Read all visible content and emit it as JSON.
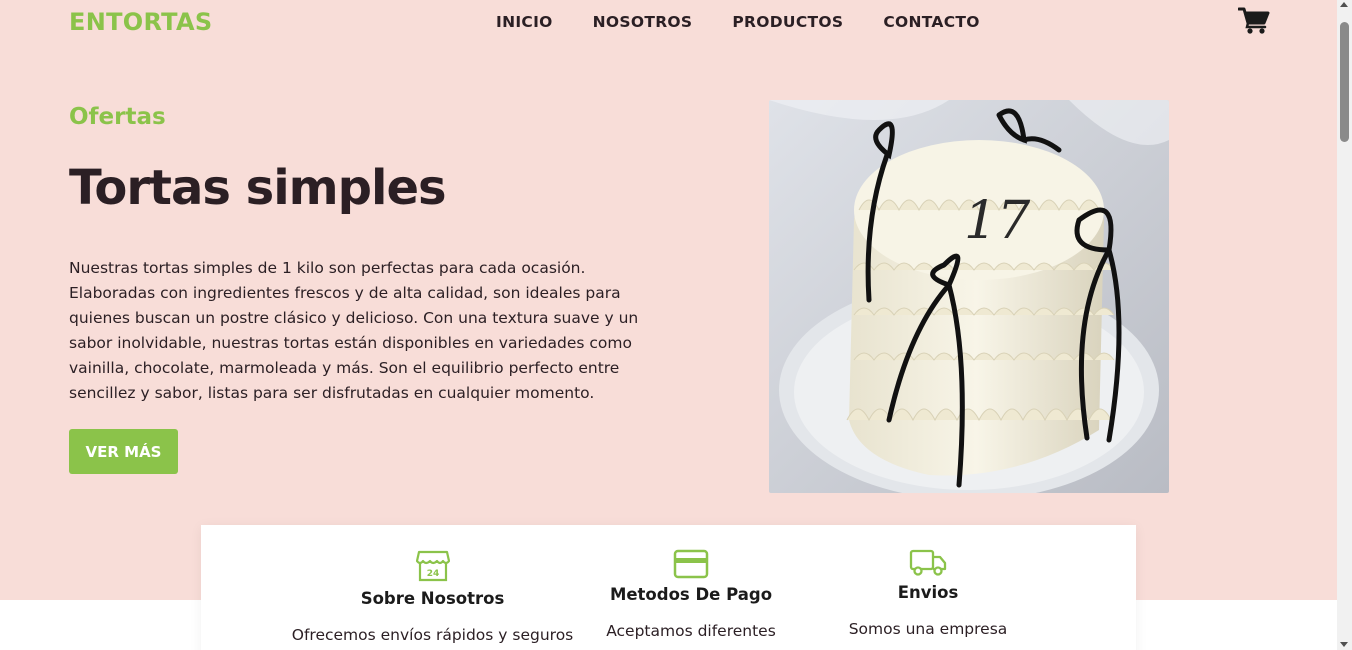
{
  "brand": {
    "name": "ENTORTAS",
    "accent": "#8bc34a",
    "hero_bg": "#f8ddd8"
  },
  "nav": {
    "items": [
      {
        "label": "INICIO"
      },
      {
        "label": "NOSOTROS"
      },
      {
        "label": "PRODUCTOS"
      },
      {
        "label": "CONTACTO"
      }
    ],
    "cart_icon": "shopping-cart-icon"
  },
  "hero": {
    "tag": "Ofertas",
    "title": "Tortas simples",
    "description": "Nuestras tortas simples de 1 kilo son perfectas para cada ocasión. Elaboradas con ingredientes frescos y de alta calidad, son ideales para quienes buscan un postre clásico y delicioso. Con una textura suave y un sabor inolvidable, nuestras tortas están disponibles en variedades como vainilla, chocolate, marmoleada y más. Son el equilibrio perfecto entre sencillez y sabor, listas para ser disfrutadas en cualquier momento.",
    "button_label": "VER MÁS",
    "image_label": "17"
  },
  "info": {
    "items": [
      {
        "icon": "store-24-icon",
        "title": "Sobre Nosotros",
        "text": "Ofrecemos envíos rápidos y seguros"
      },
      {
        "icon": "credit-card-icon",
        "title": "Metodos De Pago",
        "text": "Aceptamos diferentes"
      },
      {
        "icon": "truck-icon",
        "title": "Envios",
        "text": "Somos una empresa"
      }
    ]
  }
}
